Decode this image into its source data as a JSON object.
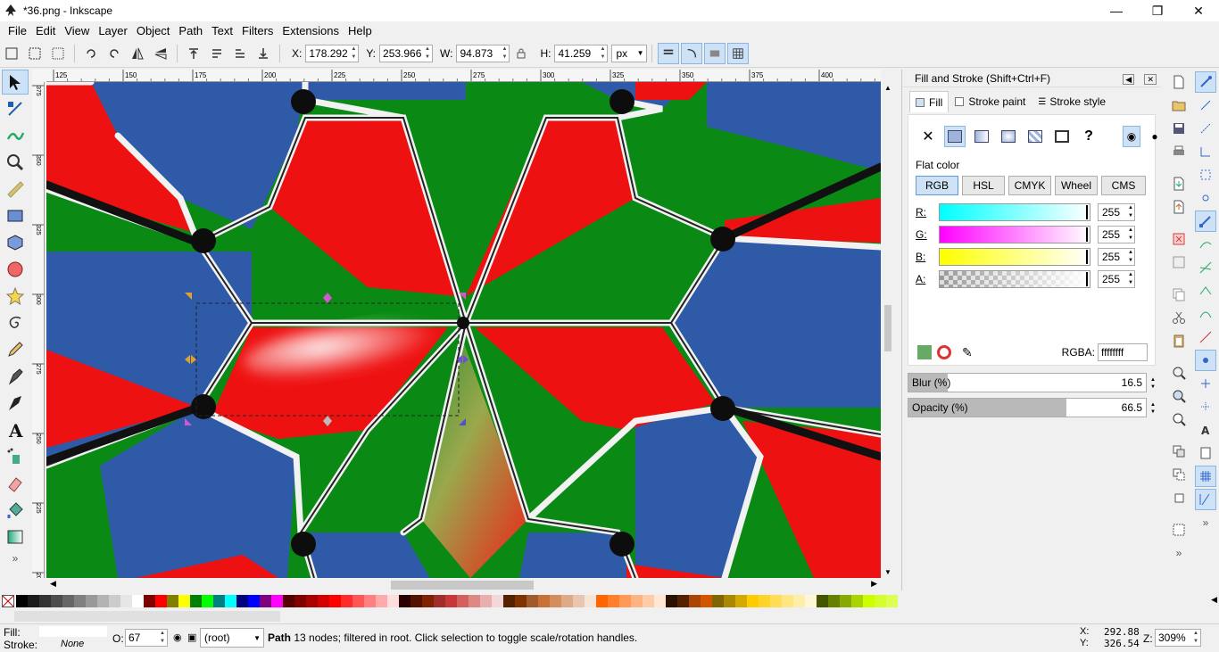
{
  "window": {
    "title": "*36.png - Inkscape",
    "controls": [
      "minimize-icon",
      "restore-icon",
      "close-icon"
    ]
  },
  "menu": [
    "File",
    "Edit",
    "View",
    "Layer",
    "Object",
    "Path",
    "Text",
    "Filters",
    "Extensions",
    "Help"
  ],
  "toolbar": {
    "x_label": "X:",
    "x_value": "178.292",
    "y_label": "Y:",
    "y_value": "253.966",
    "w_label": "W:",
    "w_value": "94.873",
    "h_label": "H:",
    "h_value": "41.259",
    "unit": "px"
  },
  "ruler": {
    "h_ticks": [
      "125",
      "150",
      "175",
      "200",
      "225",
      "250",
      "275",
      "300",
      "325",
      "350",
      "375",
      "400"
    ],
    "v_ticks": [
      "375",
      "350",
      "325",
      "300",
      "275",
      "250",
      "225",
      "200",
      "175"
    ]
  },
  "dock": {
    "title": "Fill and Stroke (Shift+Ctrl+F)",
    "tabs": [
      "Fill",
      "Stroke paint",
      "Stroke style"
    ],
    "active_tab": "Fill",
    "flat_color_label": "Flat color",
    "modes": [
      "RGB",
      "HSL",
      "CMYK",
      "Wheel",
      "CMS"
    ],
    "active_mode": "RGB",
    "channels": [
      {
        "label": "R:",
        "value": "255"
      },
      {
        "label": "G:",
        "value": "255"
      },
      {
        "label": "B:",
        "value": "255"
      },
      {
        "label": "A:",
        "value": "255"
      }
    ],
    "rgba_label": "RGBA:",
    "rgba_value": "ffffffff",
    "blur_label": "Blur (%)",
    "blur_value": "16.5",
    "blur_level_percent": 16.5,
    "opacity_label": "Opacity (%)",
    "opacity_value": "66.5",
    "opacity_level_percent": 66.5
  },
  "colors": {
    "accent": "#cde2f6",
    "tile_red": "#ee1111",
    "tile_blue": "#2f5aa8",
    "tile_green": "#0a8a14"
  },
  "status": {
    "fill_label": "Fill:",
    "stroke_label": "Stroke:",
    "stroke_value": "None",
    "opacity_label": "O:",
    "opacity_value": "67",
    "layer": "(root)",
    "message_bold": "Path",
    "message": " 13 nodes; filtered in root. Click selection to toggle scale/rotation handles.",
    "x_label": "X:",
    "x_value": "292.88",
    "y_label": "Y:",
    "y_value": "326.54",
    "z_label": "Z:",
    "zoom": "309%"
  }
}
